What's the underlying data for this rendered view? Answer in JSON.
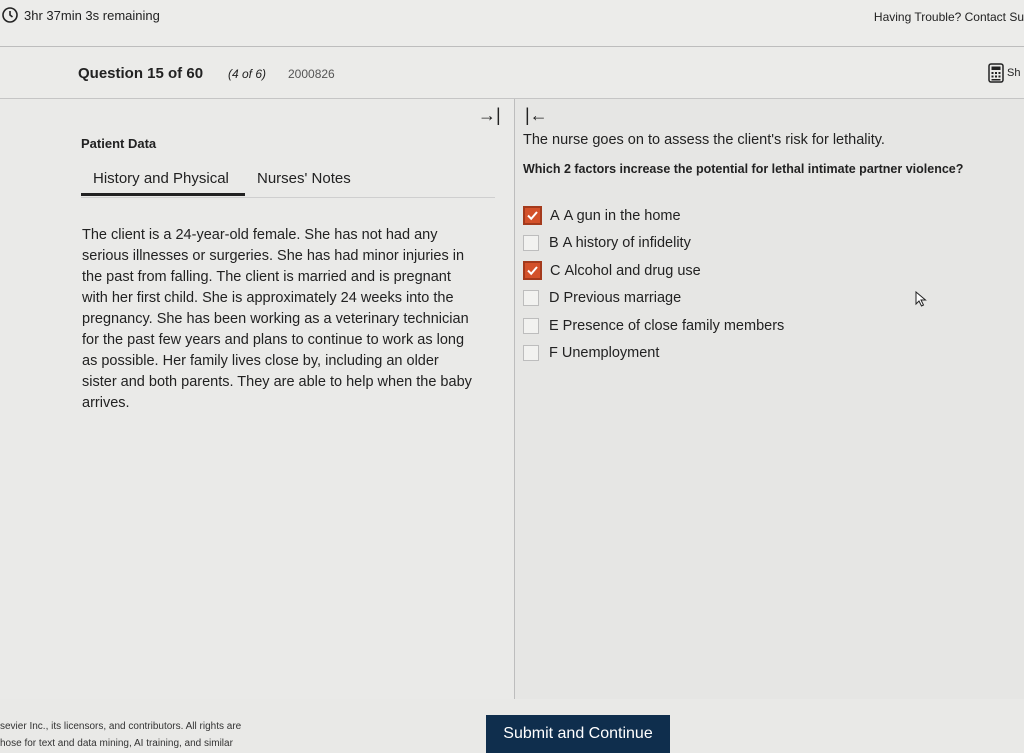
{
  "topbar": {
    "timer_text": "3hr 37min 3s remaining",
    "help_text": "Having Trouble? Contact Su"
  },
  "question_header": {
    "number": "Question 15 of 60",
    "part": "(4 of 6)",
    "id": "2000826",
    "calculator_label": "Sh"
  },
  "left_panel": {
    "collapse_icon": "→|",
    "title": "Patient Data",
    "tabs": [
      {
        "label": "History and Physical",
        "active": true
      },
      {
        "label": "Nurses' Notes",
        "active": false
      }
    ],
    "case_lines": [
      "The client is a 24-year-old female. She has not had any",
      "serious illnesses or surgeries. She has had minor injuries in",
      "the past from falling. The client is married and is pregnant",
      "with her first child. She is approximately 24 weeks into the",
      "pregnancy. She has been working as a veterinary technician",
      "for the past few years and plans to continue to work as long",
      "as possible. Her family lives close by, including an older",
      "sister and both parents. They are able to help when the baby",
      "arrives."
    ]
  },
  "right_panel": {
    "expand_icon": "|←",
    "prompt": "The nurse goes on to assess the client's risk for lethality.",
    "question": "Which 2 factors increase the potential for lethal intimate partner violence?",
    "options": [
      {
        "letter": "A",
        "text": "A gun in the home",
        "checked": true
      },
      {
        "letter": "B",
        "text": "A history of infidelity",
        "checked": false
      },
      {
        "letter": "C",
        "text": "Alcohol and drug use",
        "checked": true
      },
      {
        "letter": "D",
        "text": "Previous marriage",
        "checked": false
      },
      {
        "letter": "E",
        "text": "Presence of close family members",
        "checked": false
      },
      {
        "letter": "F",
        "text": "Unemployment",
        "checked": false
      }
    ]
  },
  "footer": {
    "line1": "sevier Inc., its licensors, and contributors. All rights are",
    "line2": "hose for text and data mining, AI training, and similar",
    "submit_label": "Submit and Continue"
  },
  "colors": {
    "checked_fill": "#d3512a",
    "submit_bg": "#0f2e4d"
  }
}
